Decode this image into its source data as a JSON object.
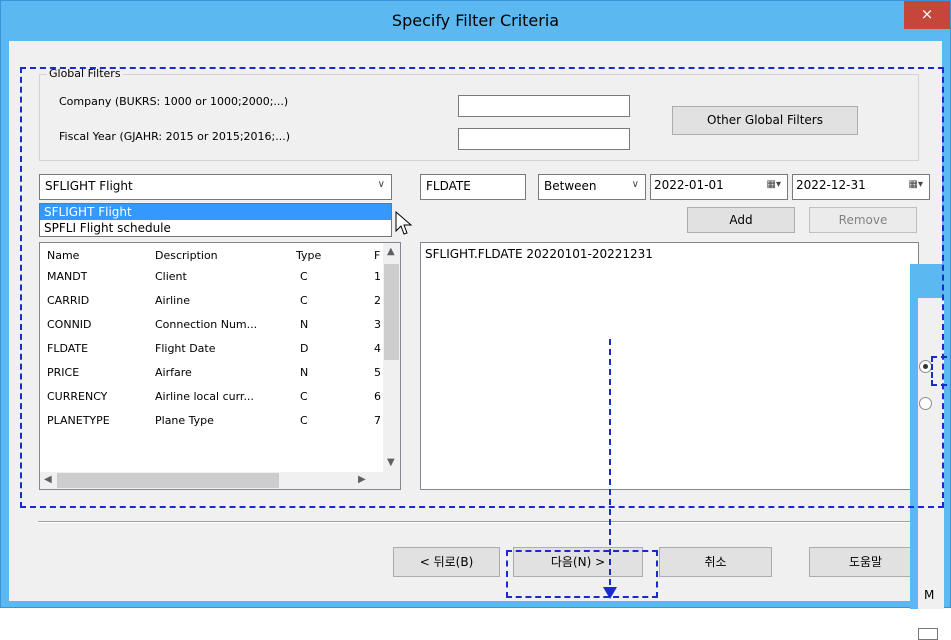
{
  "window": {
    "title": "Specify Filter Criteria",
    "close_glyph": "×"
  },
  "global_filters": {
    "legend": "Global Filters",
    "company_label": "Company (BUKRS: 1000 or 1000;2000;...)",
    "company_value": "",
    "fiscal_label": "Fiscal Year (GJAHR: 2015 or 2015;2016;...)",
    "fiscal_value": "",
    "other_button": "Other Global Filters"
  },
  "table_combo": {
    "selected": "SFLIGHT Flight",
    "options": [
      "SFLIGHT Flight",
      "SPFLI Flight schedule"
    ]
  },
  "criteria": {
    "field": "FLDATE",
    "operator": "Between",
    "date_from": "2022-01-01",
    "date_to": "2022-12-31",
    "add_button": "Add",
    "remove_button": "Remove"
  },
  "fields_list": {
    "columns": [
      "Name",
      "Description",
      "Type",
      "F"
    ],
    "rows": [
      {
        "name": "MANDT",
        "desc": "Client",
        "type": "C",
        "f": "1"
      },
      {
        "name": "CARRID",
        "desc": "Airline",
        "type": "C",
        "f": "2"
      },
      {
        "name": "CONNID",
        "desc": "Connection Num...",
        "type": "N",
        "f": "3"
      },
      {
        "name": "FLDATE",
        "desc": "Flight Date",
        "type": "D",
        "f": "4"
      },
      {
        "name": "PRICE",
        "desc": "Airfare",
        "type": "N",
        "f": "5"
      },
      {
        "name": "CURRENCY",
        "desc": "Airline local curr...",
        "type": "C",
        "f": "6"
      },
      {
        "name": "PLANETYPE",
        "desc": "Plane Type",
        "type": "C",
        "f": "7"
      }
    ]
  },
  "conditions": [
    "SFLIGHT.FLDATE 20220101-20221231"
  ],
  "footer": {
    "back": "< 뒤로(B)",
    "next": "다음(N) >",
    "cancel": "취소",
    "help": "도움말"
  },
  "background_dialog": {
    "label": "M"
  },
  "colors": {
    "accent": "#5cb8f1",
    "annotation": "#1a2bcc",
    "selection": "#3399ff",
    "close": "#c7463b"
  }
}
